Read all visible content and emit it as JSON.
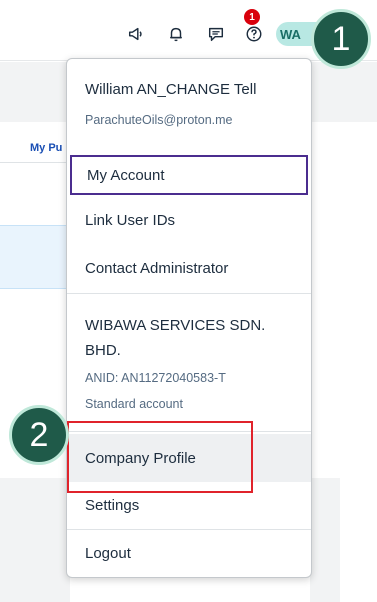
{
  "toolbar": {
    "icons": [
      "megaphone-icon",
      "bell-icon",
      "notifications-icon",
      "help-icon"
    ],
    "notification_count": "1",
    "avatar_initials": "WA"
  },
  "background": {
    "tab_label": "My Pu"
  },
  "callouts": {
    "first": "1",
    "second": "2"
  },
  "menu": {
    "user_name": "William AN_CHANGE Tell",
    "user_email": "ParachuteOils@proton.me",
    "items_top": [
      "My Account",
      "Link User IDs",
      "Contact Administrator"
    ],
    "company": {
      "name": "WIBAWA SERVICES SDN. BHD.",
      "anid": "ANID: AN11272040583-T",
      "account_type": "Standard account"
    },
    "items_bottom": [
      "Company Profile",
      "Settings"
    ],
    "logout": "Logout"
  },
  "colors": {
    "accent": "#4b2d8f",
    "highlight": "#e0232b",
    "callout": "#1f5a49",
    "badge": "#d9000c"
  }
}
